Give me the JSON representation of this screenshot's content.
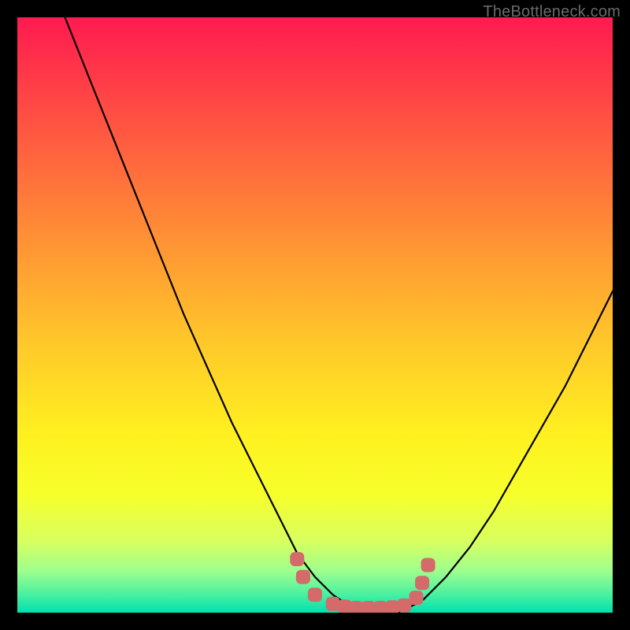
{
  "watermark": "TheBottleneck.com",
  "chart_data": {
    "type": "line",
    "title": "",
    "xlabel": "",
    "ylabel": "",
    "xlim": [
      0,
      100
    ],
    "ylim": [
      0,
      100
    ],
    "grid": false,
    "series": [
      {
        "name": "curve",
        "x": [
          8,
          12,
          16,
          20,
          24,
          28,
          32,
          36,
          40,
          44,
          47,
          50,
          53,
          56,
          60,
          64,
          68,
          72,
          76,
          80,
          84,
          88,
          92,
          96,
          100
        ],
        "values": [
          100,
          90,
          80,
          70,
          60,
          50,
          41,
          32,
          24,
          16,
          10,
          6,
          3,
          1,
          0,
          0,
          2,
          6,
          11,
          17,
          24,
          31,
          38,
          46,
          54
        ]
      }
    ],
    "markers": {
      "name": "bottom-markers",
      "color": "#d46a6a",
      "points": [
        {
          "x": 47,
          "y": 9
        },
        {
          "x": 48,
          "y": 6
        },
        {
          "x": 50,
          "y": 3
        },
        {
          "x": 53,
          "y": 1.5
        },
        {
          "x": 55,
          "y": 1
        },
        {
          "x": 57,
          "y": 0.8
        },
        {
          "x": 59,
          "y": 0.8
        },
        {
          "x": 61,
          "y": 0.8
        },
        {
          "x": 63,
          "y": 0.9
        },
        {
          "x": 65,
          "y": 1.2
        },
        {
          "x": 67,
          "y": 2.5
        },
        {
          "x": 68,
          "y": 5
        },
        {
          "x": 69,
          "y": 8
        }
      ]
    },
    "gradient_stops": [
      {
        "pos": 0,
        "color": "#ff1a50"
      },
      {
        "pos": 25,
        "color": "#ff6a3d"
      },
      {
        "pos": 55,
        "color": "#ffc92a"
      },
      {
        "pos": 80,
        "color": "#f7ff2a"
      },
      {
        "pos": 100,
        "color": "#00e0b0"
      }
    ]
  }
}
